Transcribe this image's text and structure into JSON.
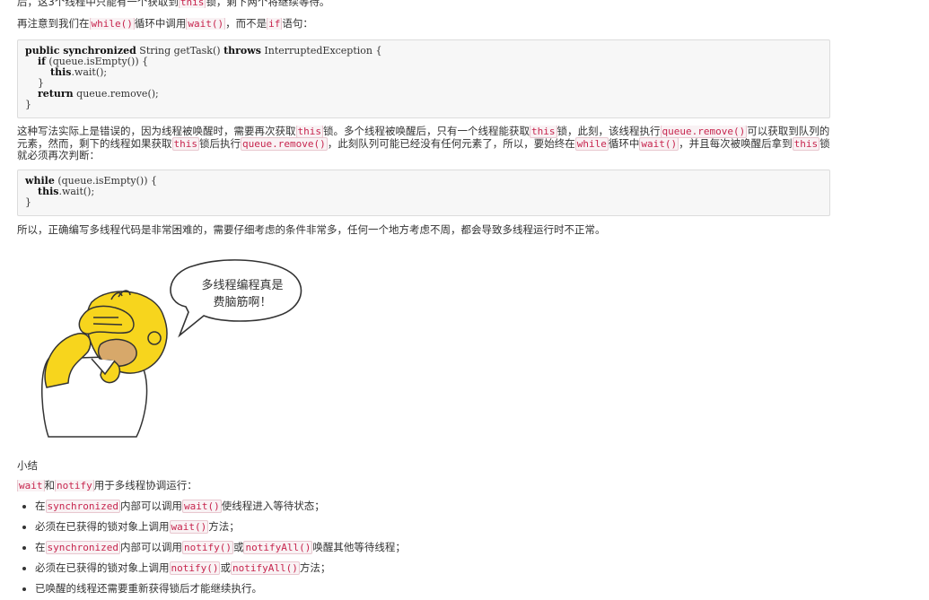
{
  "top_line": {
    "prefix": "后，这3个线程中只能有一个获取到",
    "code": "this",
    "suffix": "锁，剩下两个将继续等待。"
  },
  "note_line": {
    "t1": "再注意到我们在",
    "c1": "while()",
    "t2": "循环中调用",
    "c2": "wait()",
    "t3": "，而不是",
    "c3": "if",
    "t4": "语句："
  },
  "code1": {
    "l1_kw1": "public synchronized",
    "l1_rest1": " String getTask() ",
    "l1_kw2": "throws",
    "l1_rest2": " InterruptedException {",
    "l2_kw": "if",
    "l2_rest": " (queue.isEmpty()) {",
    "l3_kw": "this",
    "l3_rest": ".wait();",
    "l4": "}",
    "l5_kw": "return",
    "l5_rest": " queue.remove();",
    "l6": "}"
  },
  "explain": {
    "t1": "这种写法实际上是错误的，因为线程被唤醒时，需要再次获取",
    "c1": "this",
    "t2": "锁。多个线程被唤醒后，只有一个线程能获取",
    "c2": "this",
    "t3": "锁，此刻，该线程执行",
    "c3": "queue.remove()",
    "t4": "可以获取到队列的元素，然而，剩下的线程如果获取",
    "c4": "this",
    "t5": "锁后执行",
    "c5": "queue.remove()",
    "t6": "，此刻队列可能已经没有任何元素了，所以，要始终在",
    "c6": "while",
    "t7": "循环中",
    "c7": "wait()",
    "t8": "，并且每次被唤醒后拿到",
    "c8": "this",
    "t9": "锁就必须再次判断："
  },
  "code2": {
    "l1_kw": "while",
    "l1_rest": " (queue.isEmpty()) {",
    "l2_kw": "this",
    "l2_rest": ".wait();",
    "l3": "}"
  },
  "conclusion": "所以，正确编写多线程代码是非常困难的，需要仔细考虑的条件非常多，任何一个地方考虑不周，都会导致多线程运行时不正常。",
  "illustration": {
    "bubble_line1": "多线程编程真是",
    "bubble_line2": "费脑筋啊！"
  },
  "summary_title": "小结",
  "summary_intro": {
    "c1": "wait",
    "t1": "和",
    "c2": "notify",
    "t2": "用于多线程协调运行："
  },
  "bullets": [
    {
      "t1": "在",
      "c1": "synchronized",
      "t2": "内部可以调用",
      "c2": "wait()",
      "t3": "使线程进入等待状态；"
    },
    {
      "t1": "必须在已获得的锁对象上调用",
      "c1": "wait()",
      "t2": "方法；"
    },
    {
      "t1": "在",
      "c1": "synchronized",
      "t2": "内部可以调用",
      "c2": "notify()",
      "t3": "或",
      "c3": "notifyAll()",
      "t4": "唤醒其他等待线程；"
    },
    {
      "t1": "必须在已获得的锁对象上调用",
      "c1": "notify()",
      "t2": "或",
      "c2": "notifyAll()",
      "t3": "方法；"
    },
    {
      "t1": "已唤醒的线程还需要重新获得锁后才能继续执行。"
    }
  ],
  "colors": {
    "code_text": "#c7254e",
    "code_bg": "#f9f2f4",
    "skin": "#f7d51d",
    "body_text": "#333333"
  }
}
